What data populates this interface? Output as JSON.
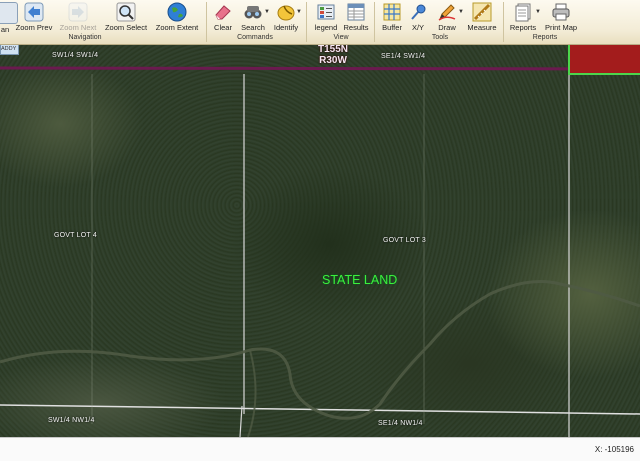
{
  "toolbar": {
    "navigation": {
      "label": "Navigation",
      "tools": [
        {
          "label": "an",
          "icon": "pan-icon",
          "enabled": true
        },
        {
          "label": "Zoom Prev",
          "icon": "arrow-left-icon",
          "enabled": true
        },
        {
          "label": "Zoom Next",
          "icon": "arrow-right-icon",
          "enabled": false
        },
        {
          "label": "Zoom Select",
          "icon": "magnifier-icon",
          "enabled": true
        },
        {
          "label": "Zoom Extent",
          "icon": "globe-icon",
          "enabled": true
        }
      ]
    },
    "commands": {
      "label": "Commands",
      "tools": [
        {
          "label": "Clear",
          "icon": "eraser-icon"
        },
        {
          "label": "Search",
          "icon": "binoculars-icon"
        },
        {
          "label": "Identify",
          "icon": "identify-icon"
        }
      ]
    },
    "view": {
      "label": "View",
      "tools": [
        {
          "label": "legend",
          "icon": "legend-icon"
        },
        {
          "label": "Results",
          "icon": "results-icon"
        }
      ]
    },
    "tools": {
      "label": "Tools",
      "tools": [
        {
          "label": "Buffer",
          "icon": "buffer-icon"
        },
        {
          "label": "X/Y",
          "icon": "pin-icon"
        },
        {
          "label": "Draw",
          "icon": "pencil-icon"
        },
        {
          "label": "Measure",
          "icon": "ruler-icon"
        }
      ]
    },
    "reports": {
      "label": "Reports",
      "tools": [
        {
          "label": "Reports",
          "icon": "report-icon"
        },
        {
          "label": "Print Map",
          "icon": "printer-icon"
        }
      ]
    }
  },
  "map": {
    "township_range": [
      "T155N",
      "R30W"
    ],
    "road_tag": "ADDY",
    "parcel_label": "STATE LAND",
    "quarter_labels": {
      "top_left": "SW1/4 SW1/4",
      "top_right": "SE1/4 SW1/4",
      "mid_left": "GOVT LOT 4",
      "mid_center": "GOVT LOT 3",
      "bottom_left": "SW1/4 NW1/4",
      "bottom_right": "SE1/4 NW1/4"
    },
    "colors": {
      "section_line": "#6b1a4f",
      "parcel_text": "#3cf03c",
      "selected_parcel": "#a31c1c",
      "grid_lines": "#d8d8d8"
    }
  },
  "status": {
    "coordinates": "X: -105196"
  }
}
